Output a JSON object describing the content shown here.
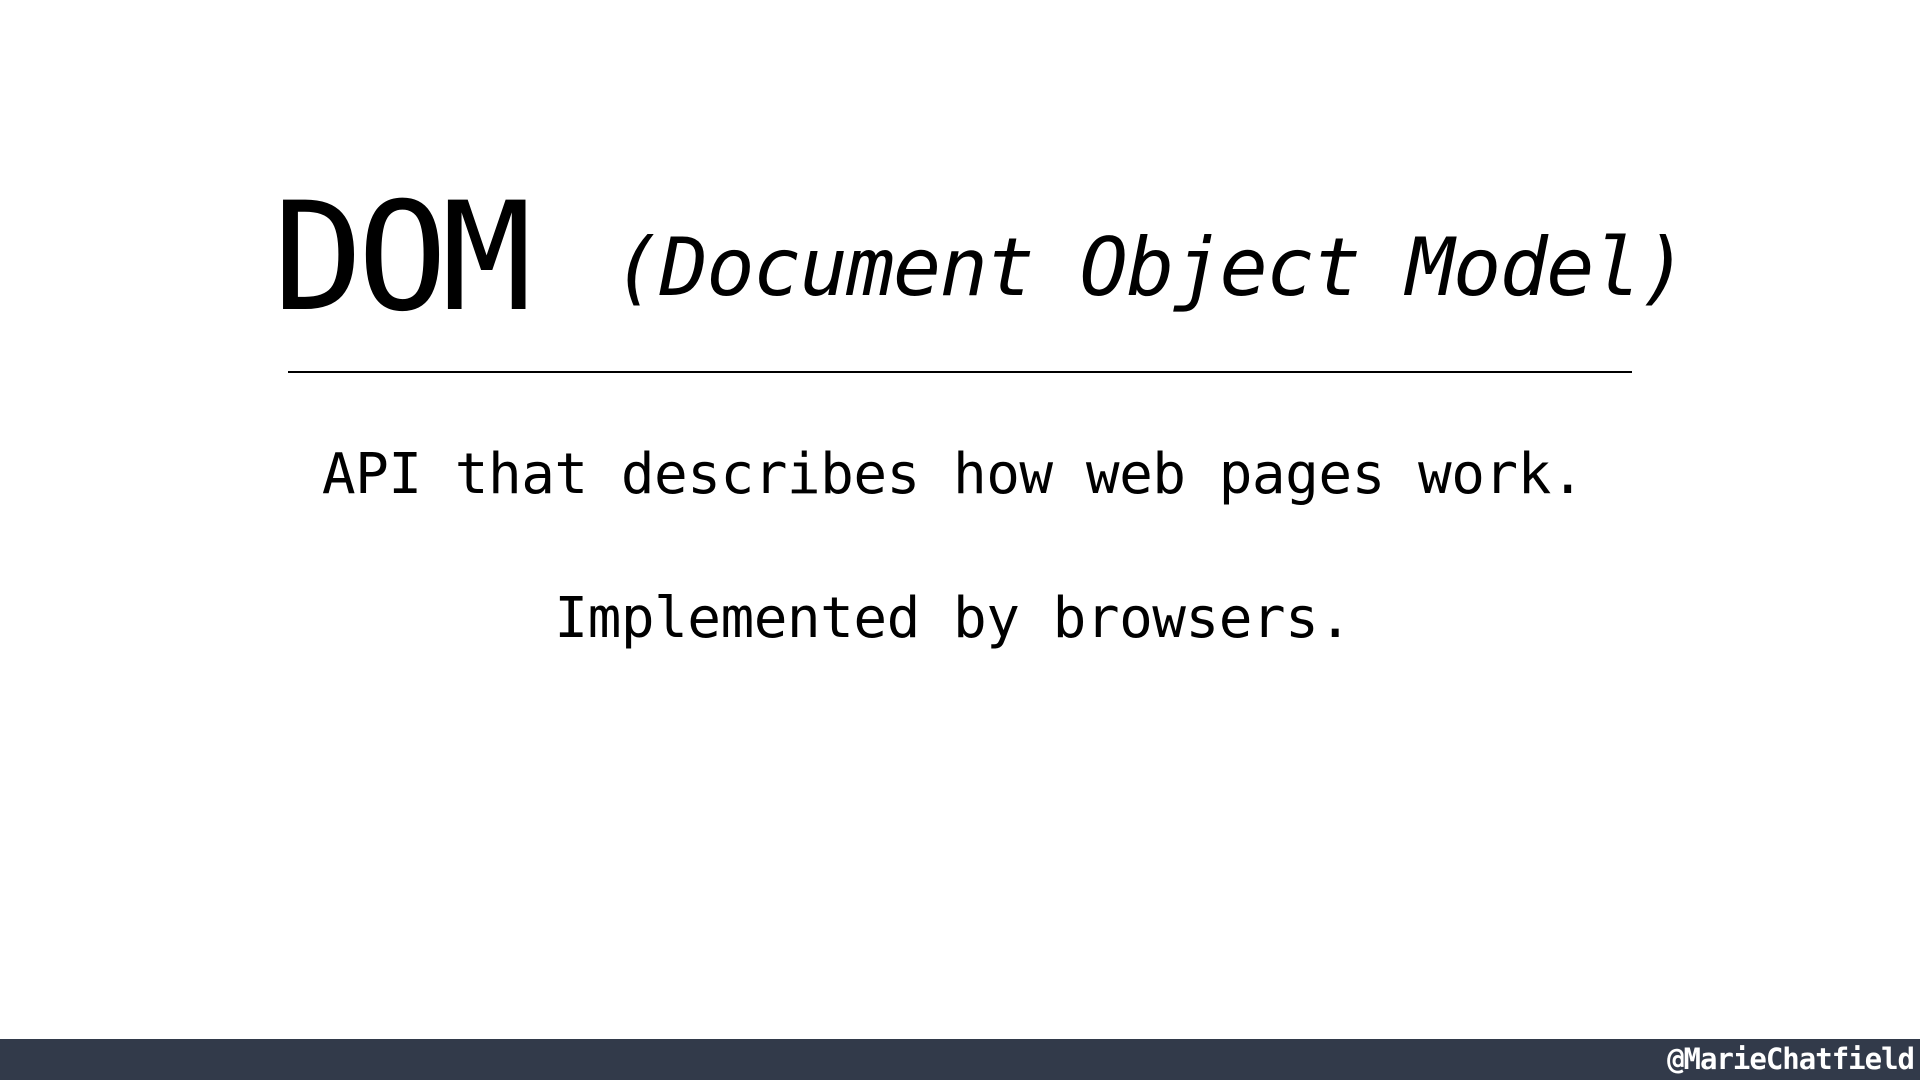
{
  "slide": {
    "title": "DOM",
    "subtitle": "(Document Object Model)",
    "lines": [
      "API that describes how web pages work.",
      "Implemented by browsers."
    ]
  },
  "footer": {
    "handle": "@MarieChatfield"
  },
  "colors": {
    "background": "#ffffff",
    "text": "#000000",
    "footer_bar": "#323a4a",
    "footer_text": "#ffffff"
  }
}
